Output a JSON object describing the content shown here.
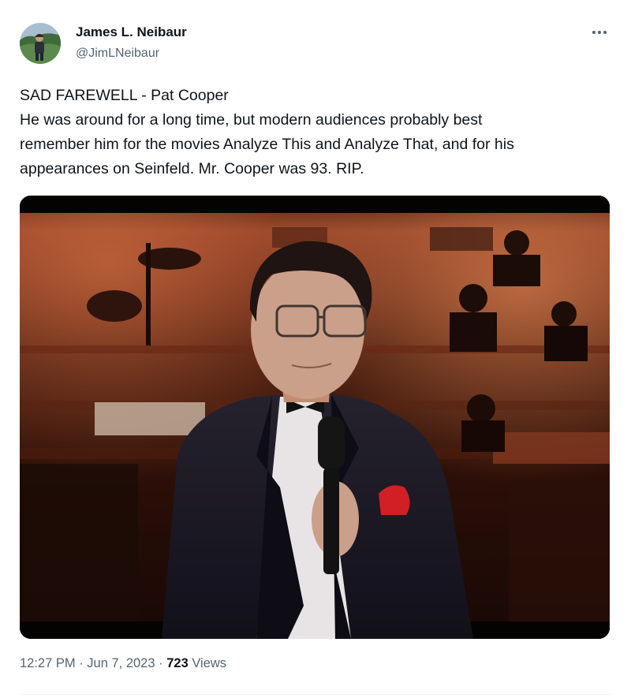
{
  "author": {
    "display_name": "James L. Neibaur",
    "handle": "@JimLNeibaur"
  },
  "tweet": {
    "text_lines": [
      "SAD FAREWELL - Pat Cooper",
      "He was around for a long time, but modern audiences probably best",
      "remember him for the movies Analyze This and Analyze That, and for his",
      "appearances on Seinfeld.  Mr. Cooper was 93.  RIP."
    ]
  },
  "meta": {
    "time": "12:27 PM",
    "separator": " · ",
    "date": "Jun 7, 2023",
    "views_count": "723",
    "views_label": " Views"
  },
  "icons": {
    "more": "more-horizontal-icon",
    "avatar": "avatar"
  },
  "colors": {
    "text_primary": "#0f1419",
    "text_secondary": "#536471",
    "divider": "#eff3f4",
    "pocket_square": "#d11f25"
  }
}
